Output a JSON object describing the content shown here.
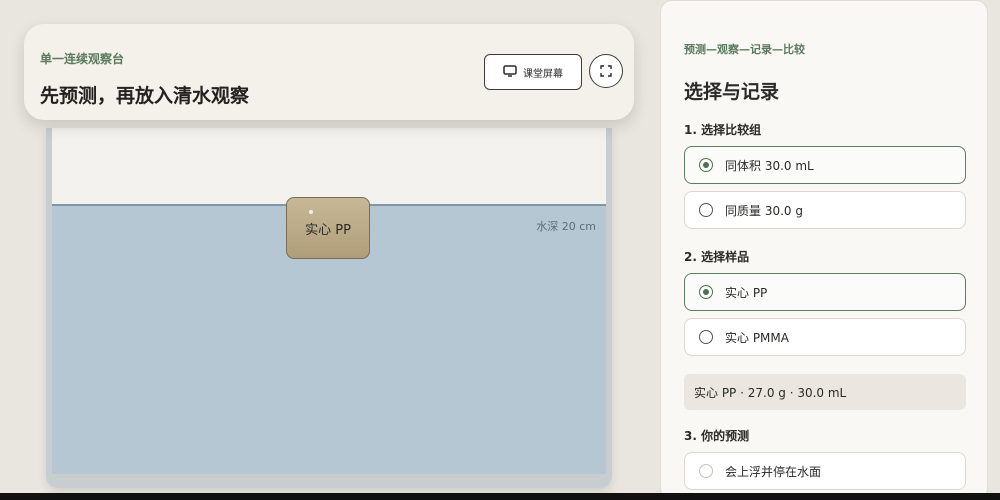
{
  "header": {
    "kicker": "单一连续观察台",
    "title": "先预测，再放入清水观察",
    "screen_button_label": "课堂屏幕",
    "screen_icon": "monitor-icon",
    "fullscreen_icon": "expand-icon"
  },
  "tank": {
    "depth_label": "水深 20 cm",
    "sample_label": "实心 PP"
  },
  "panel": {
    "kicker": "预测—观察—记录—比较",
    "title": "选择与记录",
    "sections": [
      {
        "label": "1. 选择比较组",
        "options": [
          {
            "label": "同体积 30.0 mL",
            "selected": true
          },
          {
            "label": "同质量 30.0 g",
            "selected": false
          }
        ]
      },
      {
        "label": "2. 选择样品",
        "options": [
          {
            "label": "实心 PP",
            "selected": true
          },
          {
            "label": "实心 PMMA",
            "selected": false
          }
        ]
      },
      {
        "label": "3. 你的预测",
        "options": [
          {
            "label": "会上浮并停在水面",
            "selected": false
          }
        ]
      }
    ],
    "summary": "实心 PP · 27.0 g · 30.0 mL"
  },
  "colors": {
    "accent_green": "#5b7a5e",
    "water": "#b5c7d3",
    "sample": "#b9a885"
  }
}
